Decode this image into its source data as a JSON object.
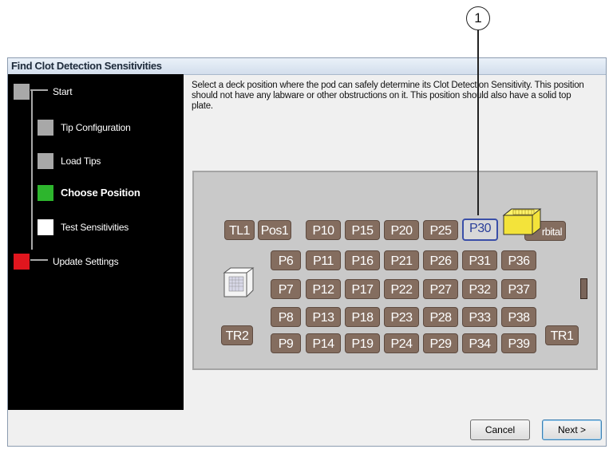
{
  "callout": {
    "number": "1"
  },
  "dialog": {
    "title": "Find Clot Detection Sensitivities",
    "steps": [
      {
        "label": "Start",
        "color": "#a8a8a8",
        "state": "done"
      },
      {
        "label": "Tip Configuration",
        "color": "#a8a8a8",
        "state": "done"
      },
      {
        "label": "Load Tips",
        "color": "#a8a8a8",
        "state": "done"
      },
      {
        "label": "Choose Position",
        "color": "#2db52d",
        "state": "current"
      },
      {
        "label": "Test Sensitivities",
        "color": "#ffffff",
        "state": "pending"
      },
      {
        "label": "Update Settings",
        "color": "#e0161e",
        "state": "pending"
      }
    ],
    "instructions": "Select a deck position where the pod can safely determine its Clot Detection Sensitivity.  This position should not have any labware or other obstructions on it.  This position should also have a solid top plate.",
    "deck": {
      "selected": "P30",
      "row0": [
        "TL1",
        "Pos1",
        "P10",
        "P15",
        "P20",
        "P25",
        "P30"
      ],
      "orbital": "rbital",
      "row1": [
        "P6",
        "P11",
        "P16",
        "P21",
        "P26",
        "P31",
        "P36"
      ],
      "row2": [
        "P7",
        "P12",
        "P17",
        "P22",
        "P27",
        "P32",
        "P37"
      ],
      "row3": [
        "P8",
        "P13",
        "P18",
        "P23",
        "P28",
        "P33",
        "P38"
      ],
      "row4": [
        "P9",
        "P14",
        "P19",
        "P24",
        "P29",
        "P34",
        "P39"
      ],
      "tr2": "TR2",
      "tr1": "TR1"
    },
    "buttons": {
      "cancel": "Cancel",
      "next": "Next >"
    }
  }
}
